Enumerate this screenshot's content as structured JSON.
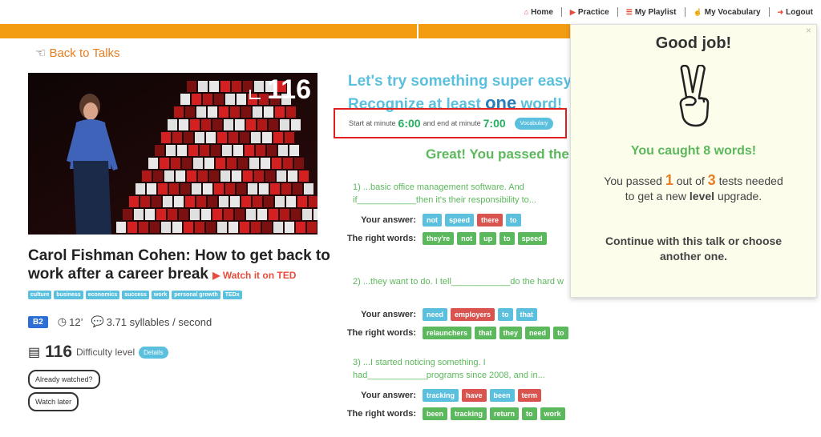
{
  "nav": {
    "items": [
      {
        "label": "Home",
        "icon": "home-icon"
      },
      {
        "label": "Practice",
        "icon": "play-circle-icon"
      },
      {
        "label": "My Playlist",
        "icon": "list-icon"
      },
      {
        "label": "My Vocabulary",
        "icon": "thumbs-up-icon"
      },
      {
        "label": "Logout",
        "icon": "sign-out-icon"
      }
    ]
  },
  "back_label": "Back to Talks",
  "thumbnail": {
    "count": "116"
  },
  "talk": {
    "title": "Carol Fishman Cohen: How to get back to work after a career break",
    "watch_ted": "Watch it on TED",
    "tags": [
      "culture",
      "business",
      "economics",
      "success",
      "work",
      "personal growth",
      "TEDx"
    ],
    "level": "B2",
    "duration": "12’",
    "syllables": "3.71",
    "syllables_unit": "syllables / second",
    "difficulty_value": "116",
    "difficulty_label": "Difficulty level",
    "details_label": "Details",
    "already_watched": "Already watched?",
    "watch_later": "Watch later"
  },
  "exercise": {
    "headline1": "Let's try something super easy",
    "headline2_pre": "Recognize at least",
    "headline2_one": "one",
    "headline2_post": "word!",
    "start_label": "Start at minute",
    "start_value": "6:00",
    "end_label": "and end at minute",
    "end_value": "7:00",
    "vocab_label": "Vocabulary",
    "passed_text": "Great! You passed the",
    "answer_label": "Your answer:",
    "right_label": "The right words:",
    "questions": [
      {
        "text": "1) ...basic office management software. And if____________then it's their responsibility to...",
        "answer": [
          {
            "w": "not",
            "c": "blue"
          },
          {
            "w": "speed",
            "c": "blue"
          },
          {
            "w": "there",
            "c": "red"
          },
          {
            "w": "to",
            "c": "blue"
          }
        ],
        "right": [
          "they're",
          "not",
          "up",
          "to",
          "speed"
        ]
      },
      {
        "text": "2) ...they want to do. I tell____________do the hard w",
        "answer": [
          {
            "w": "need",
            "c": "blue"
          },
          {
            "w": "employers",
            "c": "red"
          },
          {
            "w": "to",
            "c": "blue"
          },
          {
            "w": "that",
            "c": "blue"
          }
        ],
        "right": [
          "relaunchers",
          "that",
          "they",
          "need",
          "to"
        ]
      },
      {
        "text": "3) ...I started noticing something. I had____________programs since 2008, and in...",
        "answer": [
          {
            "w": "tracking",
            "c": "blue"
          },
          {
            "w": "have",
            "c": "red"
          },
          {
            "w": "been",
            "c": "blue"
          },
          {
            "w": "term",
            "c": "red"
          }
        ],
        "right": [
          "been",
          "tracking",
          "return",
          "to",
          "work"
        ]
      }
    ]
  },
  "popup": {
    "close": "×",
    "title": "Good job!",
    "caught": "You caught 8 words!",
    "passed_pre": "You passed",
    "passed_num": "1",
    "passed_mid": "out of",
    "passed_total": "3",
    "passed_post": "tests needed to get a new",
    "level_word": "level",
    "upgrade": "upgrade.",
    "continue_text": "Continue with this talk or choose another one."
  },
  "colors": {
    "accent_orange": "#f39c12",
    "green": "#5cb85c",
    "blue": "#5bc0de",
    "red": "#d9534f"
  }
}
